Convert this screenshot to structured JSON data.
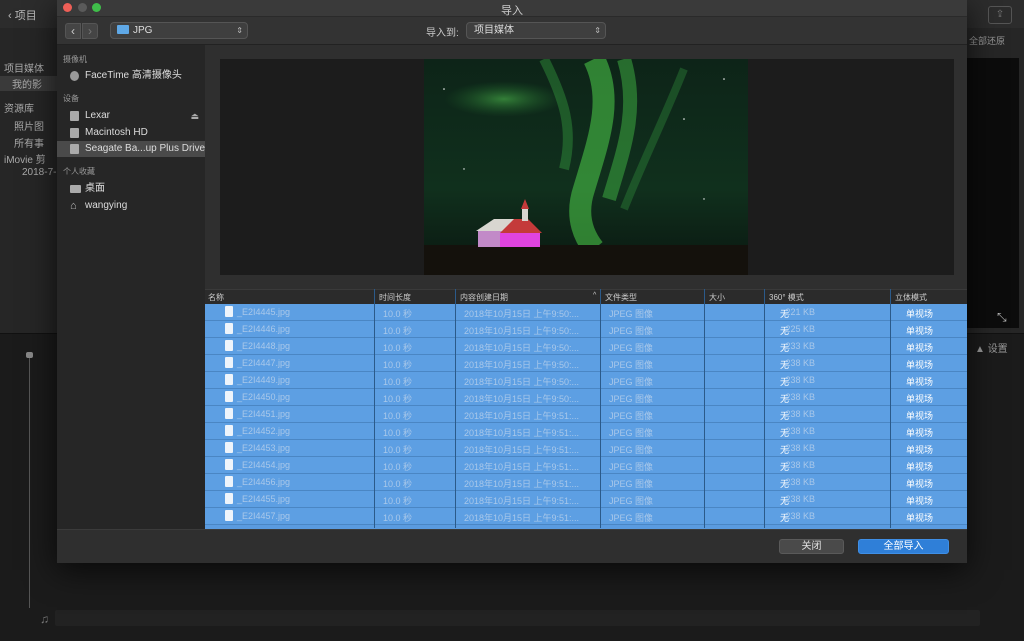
{
  "background": {
    "back_label": "项目",
    "side_items": [
      "项目媒体",
      "我的影",
      "资源库",
      "照片图",
      "所有事",
      "iMovie 剪",
      "2018-7-"
    ],
    "right_label": "全部还原",
    "settings_label": "设置",
    "note_icon": "♫"
  },
  "dialog": {
    "title": "导入",
    "toolbar": {
      "back_icon": "‹",
      "forward_icon": "›",
      "folder_value": "JPG",
      "import_to_label": "导入到:",
      "import_to_value": "项目媒体"
    },
    "sidebar": {
      "sections": {
        "cameras": "摄像机",
        "devices": "设备",
        "favorites": "个人收藏"
      },
      "cameras": [
        {
          "label": "FaceTime 高清摄像头",
          "icon": "camera-icon"
        }
      ],
      "devices": [
        {
          "label": "Lexar",
          "icon": "drive-icon",
          "eject": "⏏"
        },
        {
          "label": "Macintosh HD",
          "icon": "drive-icon"
        },
        {
          "label": "Seagate Ba...up Plus Drive",
          "icon": "drive-icon",
          "selected": true
        }
      ],
      "favorites": [
        {
          "label": "桌面",
          "icon": "desktop-icon"
        },
        {
          "label": "wangying",
          "icon": "home-icon"
        }
      ]
    },
    "columns": {
      "name": "名称",
      "duration": "时间长度",
      "created": "内容创建日期",
      "type": "文件类型",
      "size": "大小",
      "mode360": "360° 模式",
      "stereo": "立体模式"
    },
    "rows": [
      {
        "name": "_E2I4445.jpg",
        "duration": "10.0 秒",
        "created": "2018年10月15日 上午9:50:...",
        "type": "JPEG 图像",
        "size": "221 KB",
        "mode360": "无",
        "stereo": "单视场"
      },
      {
        "name": "_E2I4446.jpg",
        "duration": "10.0 秒",
        "created": "2018年10月15日 上午9:50:...",
        "type": "JPEG 图像",
        "size": "225 KB",
        "mode360": "无",
        "stereo": "单视场"
      },
      {
        "name": "_E2I4448.jpg",
        "duration": "10.0 秒",
        "created": "2018年10月15日 上午9:50:...",
        "type": "JPEG 图像",
        "size": "233 KB",
        "mode360": "无",
        "stereo": "单视场"
      },
      {
        "name": "_E2I4447.jpg",
        "duration": "10.0 秒",
        "created": "2018年10月15日 上午9:50:...",
        "type": "JPEG 图像",
        "size": "238 KB",
        "mode360": "无",
        "stereo": "单视场"
      },
      {
        "name": "_E2I4449.jpg",
        "duration": "10.0 秒",
        "created": "2018年10月15日 上午9:50:...",
        "type": "JPEG 图像",
        "size": "238 KB",
        "mode360": "无",
        "stereo": "单视场"
      },
      {
        "name": "_E2I4450.jpg",
        "duration": "10.0 秒",
        "created": "2018年10月15日 上午9:50:...",
        "type": "JPEG 图像",
        "size": "238 KB",
        "mode360": "无",
        "stereo": "单视场"
      },
      {
        "name": "_E2I4451.jpg",
        "duration": "10.0 秒",
        "created": "2018年10月15日 上午9:51:...",
        "type": "JPEG 图像",
        "size": "238 KB",
        "mode360": "无",
        "stereo": "单视场"
      },
      {
        "name": "_E2I4452.jpg",
        "duration": "10.0 秒",
        "created": "2018年10月15日 上午9:51:...",
        "type": "JPEG 图像",
        "size": "238 KB",
        "mode360": "无",
        "stereo": "单视场"
      },
      {
        "name": "_E2I4453.jpg",
        "duration": "10.0 秒",
        "created": "2018年10月15日 上午9:51:...",
        "type": "JPEG 图像",
        "size": "238 KB",
        "mode360": "无",
        "stereo": "单视场"
      },
      {
        "name": "_E2I4454.jpg",
        "duration": "10.0 秒",
        "created": "2018年10月15日 上午9:51:...",
        "type": "JPEG 图像",
        "size": "238 KB",
        "mode360": "无",
        "stereo": "单视场"
      },
      {
        "name": "_E2I4456.jpg",
        "duration": "10.0 秒",
        "created": "2018年10月15日 上午9:51:...",
        "type": "JPEG 图像",
        "size": "238 KB",
        "mode360": "无",
        "stereo": "单视场"
      },
      {
        "name": "_E2I4455.jpg",
        "duration": "10.0 秒",
        "created": "2018年10月15日 上午9:51:...",
        "type": "JPEG 图像",
        "size": "238 KB",
        "mode360": "无",
        "stereo": "单视场"
      },
      {
        "name": "_E2I4457.jpg",
        "duration": "10.0 秒",
        "created": "2018年10月15日 上午9:51:...",
        "type": "JPEG 图像",
        "size": "238 KB",
        "mode360": "无",
        "stereo": "单视场"
      }
    ],
    "buttons": {
      "close": "关闭",
      "import_all": "全部导入"
    },
    "colors": {
      "selection": "#5d9fe3",
      "accent": "#2f7fd8"
    }
  }
}
